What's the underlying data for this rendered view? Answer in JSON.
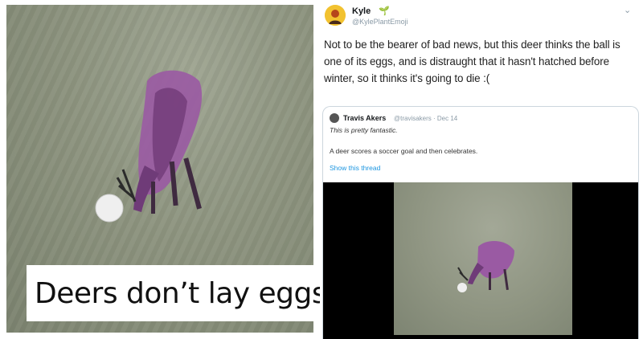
{
  "caption": "Deers don’t lay eggs my guy",
  "tweet": {
    "author_name": "Kyle",
    "handle": "@KylePlantEmoji",
    "text": "Not to be the bearer of bad news, but this deer thinks the ball is one of its eggs, and is distraught that it hasn't hatched before winter, so it thinks it's going to die :(",
    "icons": [
      "sprout-icon",
      "chevron-down-icon"
    ]
  },
  "quoted_tweet": {
    "author_name": "Travis Akers",
    "handle_date": "@travisakers · Dec 14",
    "line1": "This is pretty fantastic.",
    "line2": "A deer scores a soccer goal and then celebrates.",
    "show_thread": "Show this thread"
  }
}
